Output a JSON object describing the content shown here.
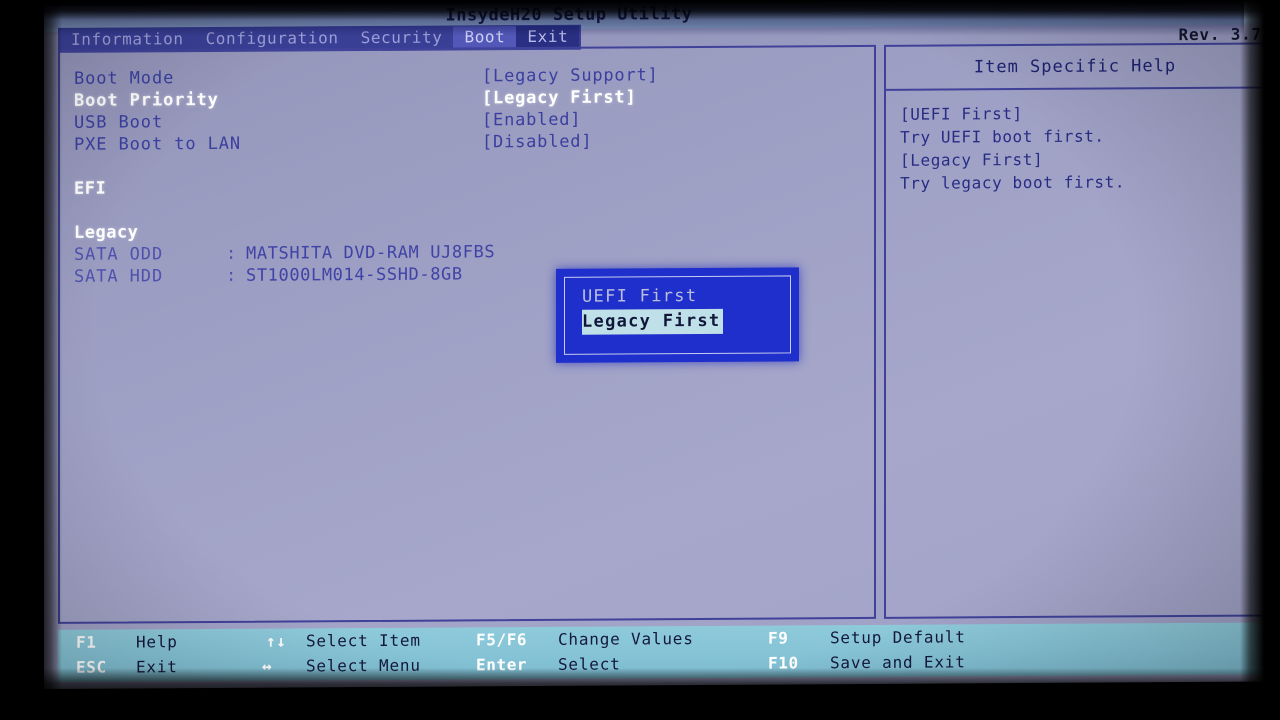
{
  "titlebar": {
    "title": "InsydeH20 Setup Utility",
    "revision": "Rev. 3.7"
  },
  "menubar": {
    "items": [
      {
        "label": "Information",
        "state": "normal"
      },
      {
        "label": "Configuration",
        "state": "normal"
      },
      {
        "label": "Security",
        "state": "normal"
      },
      {
        "label": "Boot",
        "state": "selected"
      },
      {
        "label": "Exit",
        "state": "active"
      }
    ]
  },
  "main": {
    "settings": [
      {
        "label": "Boot Mode",
        "value": "[Legacy Support]",
        "highlighted": false
      },
      {
        "label": "Boot Priority",
        "value": "[Legacy First]",
        "highlighted": true
      },
      {
        "label": "USB Boot",
        "value": "[Enabled]",
        "highlighted": false
      },
      {
        "label": "PXE Boot to LAN",
        "value": "[Disabled]",
        "highlighted": false
      }
    ],
    "groups": [
      {
        "title": "EFI",
        "devices": []
      },
      {
        "title": "Legacy",
        "devices": [
          {
            "name": "SATA ODD",
            "separator": ":",
            "value": "MATSHITA DVD-RAM UJ8FBS"
          },
          {
            "name": "SATA HDD",
            "separator": ":",
            "value": "ST1000LM014-SSHD-8GB"
          }
        ]
      }
    ]
  },
  "popup": {
    "options": [
      {
        "label": "UEFI First",
        "selected": false
      },
      {
        "label": "Legacy First",
        "selected": true
      }
    ]
  },
  "help": {
    "header": "Item Specific Help",
    "lines": [
      "[UEFI First]",
      "Try UEFI boot first.",
      "[Legacy First]",
      "Try legacy boot first."
    ]
  },
  "footer": {
    "row1": [
      {
        "key": "F1",
        "desc": "Help"
      },
      {
        "key": "↑↓",
        "desc": "Select Item"
      },
      {
        "key": "F5/F6",
        "desc": "Change Values"
      },
      {
        "key": "F9",
        "desc": "Setup Default"
      }
    ],
    "row2": [
      {
        "key": "ESC",
        "desc": "Exit"
      },
      {
        "key": "↔",
        "desc": "Select Menu"
      },
      {
        "key": "Enter",
        "desc": "Select"
      },
      {
        "key": "F10",
        "desc": "Save and Exit"
      }
    ]
  },
  "colors": {
    "screen_bg": "#9a9cc2",
    "text_blue": "#3a3fa0",
    "text_white": "#ffffff",
    "menu_bar": "#3a3f96",
    "menu_selected": "#5358b8",
    "popup_bg": "#1f2fcb",
    "popup_highlight": "#bfe0e8",
    "footer_bg": "#85c3d6",
    "border": "#40429a"
  }
}
